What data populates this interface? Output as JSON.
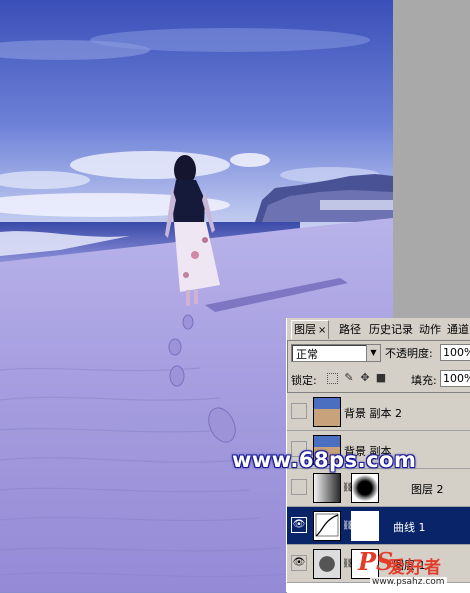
{
  "panel": {
    "tabs": [
      {
        "label": "图层",
        "close": "×"
      },
      {
        "label": "路径"
      },
      {
        "label": "历史记录"
      },
      {
        "label": "动作"
      },
      {
        "label": "通道"
      }
    ],
    "blend_mode": "正常",
    "opacity_label": "不透明度:",
    "opacity_value": "100%",
    "lock_label": "锁定:",
    "fill_label": "填充:",
    "fill_value": "100%",
    "layers": [
      {
        "name": "背景 副本 2",
        "visible": false,
        "selected": false,
        "icon": "photo-thumb"
      },
      {
        "name": "背景 副本",
        "visible": false,
        "selected": false,
        "icon": "photo-thumb"
      },
      {
        "name": "图层 2",
        "visible": false,
        "selected": false,
        "icon": "gradient-thumb"
      },
      {
        "name": "曲线 1",
        "visible": true,
        "selected": true,
        "icon": "curves-thumb"
      },
      {
        "name": "图层 1",
        "visible": true,
        "selected": false,
        "icon": "circle-thumb"
      }
    ]
  },
  "watermark": {
    "site": "www.68ps.com",
    "logo_letters": "PS",
    "logo_cn": "爱好者",
    "logo_url": "www.psahz.com"
  },
  "colors": {
    "selection": "#0a246a",
    "panel_bg": "#d4d0c8",
    "watermark_red": "#e23d2a",
    "watermark_blue": "#1a1a9a"
  }
}
